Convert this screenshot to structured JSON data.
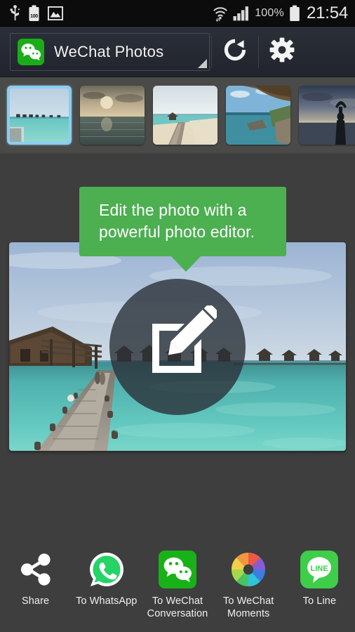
{
  "status_bar": {
    "icons_left": [
      "usb-icon",
      "battery-charging-icon",
      "gallery-icon"
    ],
    "battery_level_text": "100",
    "wifi_icon": "wifi-icon",
    "signal_icon": "cellular-signal-icon",
    "battery_percent": "100%",
    "battery_icon": "battery-full-icon",
    "clock": "21:54"
  },
  "action_bar": {
    "spinner": {
      "icon": "wechat-logo-icon",
      "label": "WeChat Photos",
      "caret": "dropdown-caret-icon"
    },
    "refresh_label": "refresh-icon",
    "settings_label": "gear-icon"
  },
  "thumbnails": [
    {
      "name": "thumb-overwater-bungalows",
      "selected": true,
      "alt": "Turquoise lagoon with overwater bungalows"
    },
    {
      "name": "thumb-sunset-sea",
      "selected": false,
      "alt": "Sunset over the sea with clouds"
    },
    {
      "name": "thumb-pier-beach",
      "selected": false,
      "alt": "Wooden pier leading to beach"
    },
    {
      "name": "thumb-rocky-cove",
      "selected": false,
      "alt": "Rocky tropical cove with palms"
    },
    {
      "name": "thumb-silhouette-sunset",
      "selected": false,
      "alt": "Person silhouette at sunset"
    }
  ],
  "tooltip": {
    "line1": "Edit the photo with a",
    "line2": "powerful photo editor."
  },
  "main_photo": {
    "alt": "Maldives wooden pier with overwater villas and turquoise lagoon",
    "edit_button_icon": "edit-pencil-icon"
  },
  "bottom_actions": [
    {
      "icon": "share-icon",
      "label": "Share"
    },
    {
      "icon": "whatsapp-icon",
      "label": "To WhatsApp"
    },
    {
      "icon": "wechat-icon",
      "label": "To WeChat Conversation"
    },
    {
      "icon": "wechat-moments-icon",
      "label": "To WeChat Moments"
    },
    {
      "icon": "line-icon",
      "label": "To Line"
    }
  ],
  "colors": {
    "background": "#3e3e3e",
    "status_bar": "#0c0c0c",
    "action_bar": "#262a33",
    "thumb_strip": "#4a4a48",
    "tooltip_green": "#4caf50",
    "wechat_green": "#1aad19",
    "whatsapp_green": "#25d366",
    "line_green": "#3ece4a",
    "selection_blue": "#8ccdf2"
  }
}
